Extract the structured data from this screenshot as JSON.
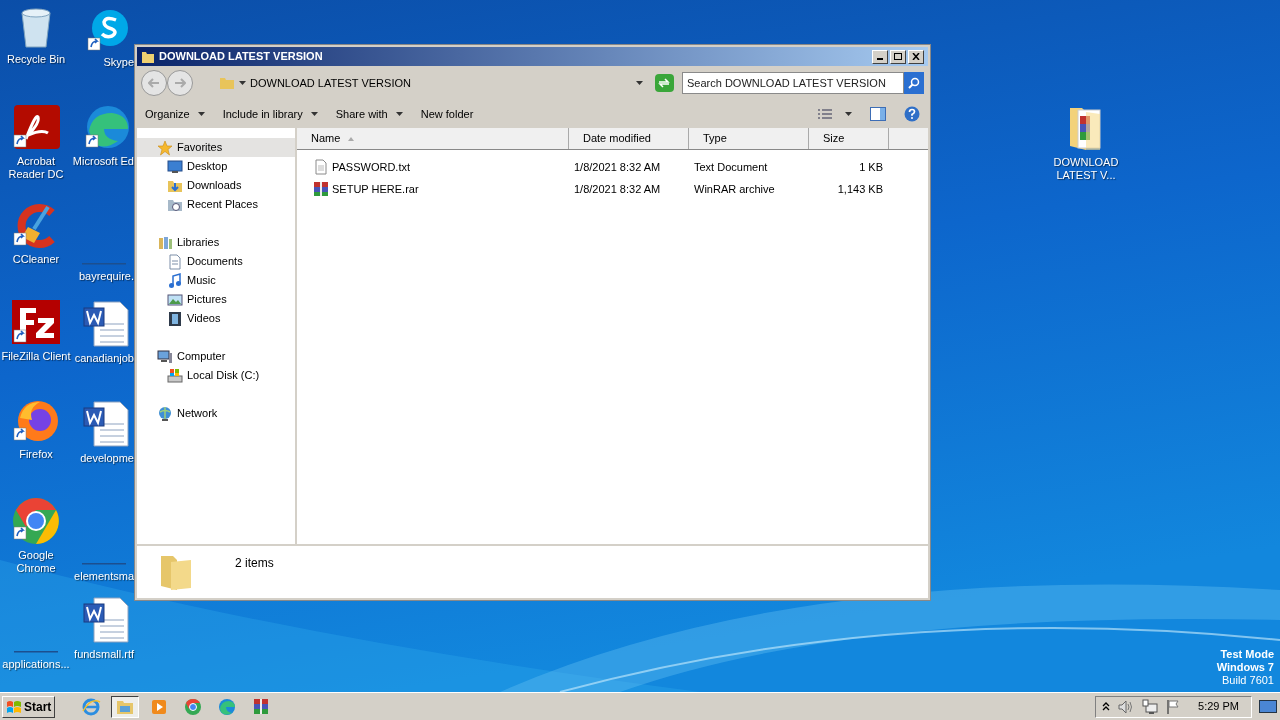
{
  "desktop": {
    "left_column": [
      {
        "label": "Recycle Bin",
        "kind": "recycle"
      },
      {
        "label": "Acrobat Reader DC",
        "kind": "acrobat"
      },
      {
        "label": "CCleaner",
        "kind": "ccleaner"
      },
      {
        "label": "FileZilla Client",
        "kind": "filezilla"
      },
      {
        "label": "Firefox",
        "kind": "firefox"
      },
      {
        "label": "Google Chrome",
        "kind": "chrome"
      },
      {
        "label": "applications...",
        "kind": "blank"
      }
    ],
    "second_column": [
      {
        "label": "Skype",
        "kind": "skype"
      },
      {
        "label": "Microsoft Ed",
        "kind": "edge"
      },
      {
        "label": "bayrequire.",
        "kind": "blank"
      },
      {
        "label": "canadianjob",
        "kind": "word"
      },
      {
        "label": "developme",
        "kind": "word"
      },
      {
        "label": "elementsma",
        "kind": "blank"
      },
      {
        "label": "fundsmall.rtf",
        "kind": "word"
      }
    ],
    "right_icons": [
      {
        "label": "DOWNLOAD LATEST V...",
        "kind": "archive-folder"
      }
    ],
    "watermark": [
      "Test Mode",
      "Windows 7",
      "Build 7601"
    ]
  },
  "window": {
    "title": "DOWNLOAD LATEST VERSION",
    "address": "DOWNLOAD LATEST VERSION",
    "search": {
      "placeholder": "Search DOWNLOAD LATEST VERSION"
    },
    "toolbar": [
      {
        "label": "Organize",
        "dropdown": true
      },
      {
        "label": "Include in library",
        "dropdown": true
      },
      {
        "label": "Share with",
        "dropdown": true
      },
      {
        "label": "New folder",
        "dropdown": false
      }
    ],
    "navigation": [
      {
        "label": "Favorites",
        "kind": "star",
        "selected": true,
        "children": [
          {
            "label": "Desktop",
            "kind": "desktop",
            "selected": false
          },
          {
            "label": "Downloads",
            "kind": "downloads",
            "selected": false
          },
          {
            "label": "Recent Places",
            "kind": "recent",
            "selected": false
          }
        ]
      },
      {
        "label": "Libraries",
        "kind": "library",
        "selected": false,
        "children": [
          {
            "label": "Documents",
            "kind": "documents",
            "selected": false
          },
          {
            "label": "Music",
            "kind": "music",
            "selected": false
          },
          {
            "label": "Pictures",
            "kind": "pictures",
            "selected": false
          },
          {
            "label": "Videos",
            "kind": "videos",
            "selected": false
          }
        ]
      },
      {
        "label": "Computer",
        "kind": "computer",
        "selected": false,
        "children": [
          {
            "label": "Local Disk (C:)",
            "kind": "disk",
            "selected": false
          }
        ]
      },
      {
        "label": "Network",
        "kind": "network",
        "selected": false
      }
    ],
    "columns": [
      {
        "label": "Name",
        "sorted": true
      },
      {
        "label": "Date modified",
        "sorted": false
      },
      {
        "label": "Type",
        "sorted": false
      },
      {
        "label": "Size",
        "sorted": false
      }
    ],
    "files": [
      {
        "name": "PASSWORD.txt",
        "kind": "text",
        "date": "1/8/2021 8:32 AM",
        "type": "Text Document",
        "size": "1 KB"
      },
      {
        "name": "SETUP HERE.rar",
        "kind": "archive",
        "date": "1/8/2021 8:32 AM",
        "type": "WinRAR archive",
        "size": "1,143 KB"
      }
    ],
    "status": "2 items"
  },
  "taskbar": {
    "start": "Start",
    "apps": [
      {
        "kind": "ie",
        "active": false
      },
      {
        "kind": "explorer",
        "active": true
      },
      {
        "kind": "media",
        "active": false
      },
      {
        "kind": "chrome",
        "active": false
      },
      {
        "kind": "edge",
        "active": false
      },
      {
        "kind": "winrar",
        "active": false
      }
    ],
    "clock": "5:29 PM"
  }
}
